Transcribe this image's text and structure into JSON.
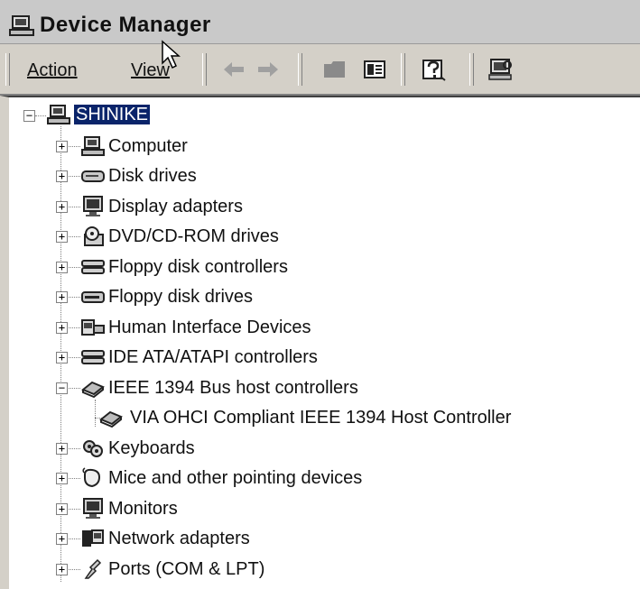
{
  "window": {
    "title": "Device Manager"
  },
  "toolbar": {
    "menus": [
      {
        "label": "Action"
      },
      {
        "label": "View"
      }
    ],
    "buttons": [
      {
        "icon": "back-arrow-icon"
      },
      {
        "icon": "forward-arrow-icon"
      },
      {
        "icon": "folder-icon"
      },
      {
        "icon": "properties-icon"
      },
      {
        "icon": "help-icon"
      },
      {
        "icon": "scan-hardware-icon"
      }
    ]
  },
  "tree": {
    "root": {
      "label": "SHINIKE",
      "expanded": true,
      "selected": true
    },
    "items": [
      {
        "label": "Computer",
        "icon": "computer-icon",
        "expanded": false
      },
      {
        "label": "Disk drives",
        "icon": "disk-drive-icon",
        "expanded": false
      },
      {
        "label": "Display adapters",
        "icon": "monitor-icon",
        "expanded": false
      },
      {
        "label": "DVD/CD-ROM drives",
        "icon": "cdrom-icon",
        "expanded": false
      },
      {
        "label": "Floppy disk controllers",
        "icon": "controller-icon",
        "expanded": false
      },
      {
        "label": "Floppy disk drives",
        "icon": "floppy-icon",
        "expanded": false
      },
      {
        "label": "Human Interface Devices",
        "icon": "hid-icon",
        "expanded": false
      },
      {
        "label": "IDE ATA/ATAPI controllers",
        "icon": "controller-icon",
        "expanded": false
      },
      {
        "label": "IEEE 1394 Bus host controllers",
        "icon": "ieee1394-icon",
        "expanded": true,
        "children": [
          {
            "label": "VIA OHCI Compliant IEEE 1394 Host Controller",
            "icon": "ieee1394-icon"
          }
        ]
      },
      {
        "label": "Keyboards",
        "icon": "keyboard-icon",
        "expanded": false
      },
      {
        "label": "Mice and other pointing devices",
        "icon": "mouse-icon",
        "expanded": false
      },
      {
        "label": "Monitors",
        "icon": "monitor-icon",
        "expanded": false
      },
      {
        "label": "Network adapters",
        "icon": "network-icon",
        "expanded": false
      },
      {
        "label": "Ports (COM & LPT)",
        "icon": "port-icon",
        "expanded": false
      }
    ]
  },
  "colors": {
    "selection": "#0a246a",
    "chrome": "#d4d0c8"
  }
}
